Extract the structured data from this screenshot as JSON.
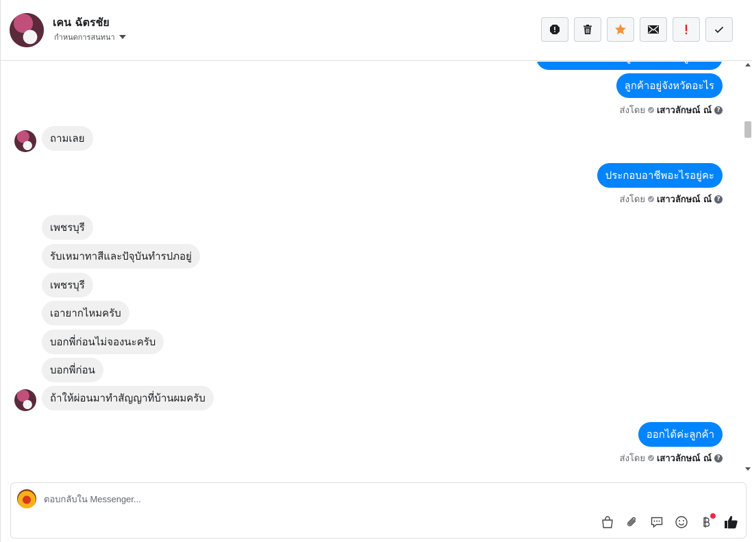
{
  "header": {
    "contact_name": "เคน ฉัตรชัย",
    "assign_label": "กำหนดการสนทนา",
    "tools": [
      {
        "name": "spam-icon"
      },
      {
        "name": "trash-icon"
      },
      {
        "name": "star-icon"
      },
      {
        "name": "mail-icon"
      },
      {
        "name": "follow-up-icon"
      },
      {
        "name": "check-icon"
      }
    ]
  },
  "messages": {
    "m0": "แล้วเพื่อนมีอาชีพอยู่ที่บริษัทพักอยู่ที่ไหน",
    "m1": "ลูกค้าอยู่จังหวัดอะไร",
    "m2": "ถามเลย",
    "m3": "ประกอบอาชีพอะไรอยู่คะ",
    "m4": "เพชรบุรี",
    "m5": "รับเหมาทาสีและปัจุบันทำรปภอยู่",
    "m6": "เพชรบุรี",
    "m7": "เอายากไหมครับ",
    "m8": "บอกพี่ก่อนไม่จองนะครับ",
    "m9": "บอกพี่ก่อน",
    "m10": "ถ้าให้ผ่อนมาทำสัญญาที่บ้านผมครับ",
    "m11": "ออกได้ค่ะลูกค้า"
  },
  "sent_by": {
    "prefix": "ส่งโดย",
    "agent": "เสาวลักษณ์ ณ์",
    "help": "?"
  },
  "composer": {
    "placeholder": "ตอบกลับใน Messenger...",
    "tools": [
      "shopping-bag-icon",
      "paperclip-icon",
      "saved-reply-icon",
      "emoji-icon",
      "baht-icon",
      "like-icon"
    ]
  },
  "colors": {
    "outgoing": "#0084ff",
    "incoming": "#f0f0f0",
    "star": "#f7923b",
    "follow_up": "#e02020"
  }
}
